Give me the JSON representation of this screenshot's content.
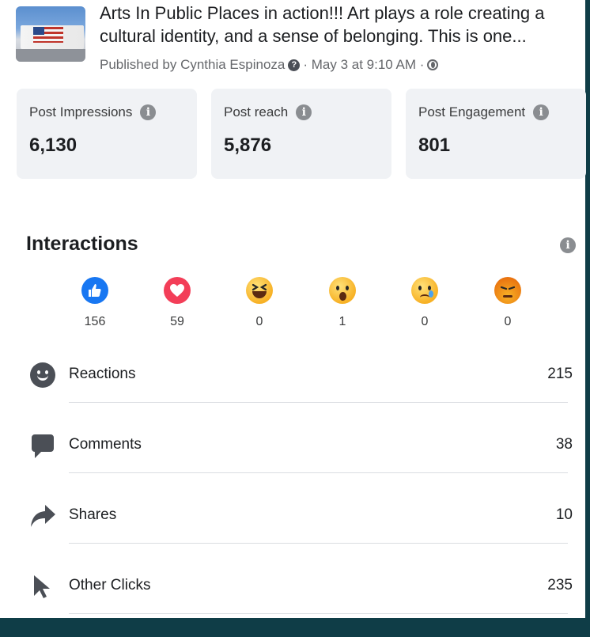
{
  "post": {
    "text": "Arts In Public Places in action!!! Art plays a role creating a cultural identity, and a sense of belonging. This is one...",
    "published": "Published by Cynthia Espinoza",
    "date": "· May 3 at 9:10 AM ·"
  },
  "stats": [
    {
      "label": "Post Impressions",
      "value": "6,130"
    },
    {
      "label": "Post reach",
      "value": "5,876"
    },
    {
      "label": "Post Engagement",
      "value": "801"
    }
  ],
  "interactions": {
    "title": "Interactions",
    "reactions": [
      {
        "type": "like",
        "count": "156"
      },
      {
        "type": "love",
        "count": "59"
      },
      {
        "type": "haha",
        "count": "0"
      },
      {
        "type": "wow",
        "count": "1"
      },
      {
        "type": "sad",
        "count": "0"
      },
      {
        "type": "angry",
        "count": "0"
      }
    ],
    "rows": [
      {
        "label": "Reactions",
        "value": "215",
        "icon": "smile-icon"
      },
      {
        "label": "Comments",
        "value": "38",
        "icon": "comment-icon"
      },
      {
        "label": "Shares",
        "value": "10",
        "icon": "share-icon"
      },
      {
        "label": "Other Clicks",
        "value": "235",
        "icon": "cursor-icon"
      }
    ]
  },
  "colors": {
    "accent": "#1877f2",
    "love": "#f33e58",
    "background": "#0f3d47"
  }
}
